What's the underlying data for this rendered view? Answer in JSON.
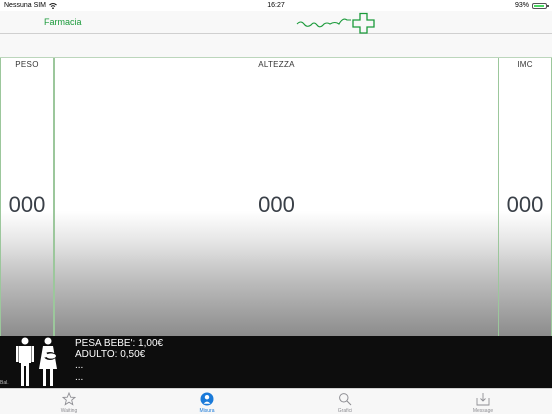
{
  "status_bar": {
    "carrier": "Nessuna SIM",
    "time": "16:27",
    "battery": "93%",
    "battery_level": 0.93
  },
  "nav": {
    "back_label": "Farmacia"
  },
  "panels": {
    "peso": {
      "title": "PESO",
      "value": "000"
    },
    "altezza": {
      "title": "ALTEZZA",
      "value": "000"
    },
    "imc": {
      "title": "IMC",
      "value": "000"
    }
  },
  "ad": {
    "lines": [
      "PESA BEBE':  1,00€",
      "ADULTO: 0,50€",
      "...",
      "..."
    ],
    "tag": "Bal."
  },
  "tabs": [
    {
      "label": "Waiting",
      "icon": "star-icon",
      "active": false
    },
    {
      "label": "Misura",
      "icon": "person-icon",
      "active": true
    },
    {
      "label": "Grafici",
      "icon": "search-icon",
      "active": false
    },
    {
      "label": "Message",
      "icon": "inbox-icon",
      "active": false
    }
  ],
  "colors": {
    "accent": "#1a9a3a",
    "tab_active": "#1a7ad9",
    "panel_border": "#9cc79c"
  }
}
